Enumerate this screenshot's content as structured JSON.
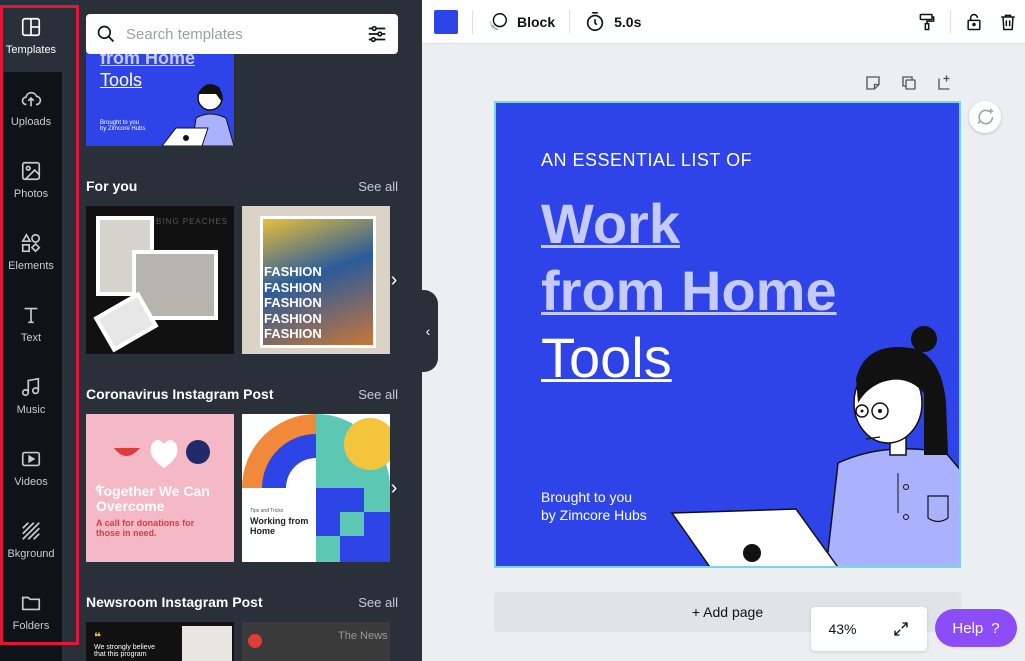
{
  "sidebar": {
    "items": [
      {
        "label": "Templates",
        "icon": "templates-icon",
        "active": true
      },
      {
        "label": "Uploads",
        "icon": "upload-icon"
      },
      {
        "label": "Photos",
        "icon": "photo-icon"
      },
      {
        "label": "Elements",
        "icon": "shapes-icon"
      },
      {
        "label": "Text",
        "icon": "text-icon"
      },
      {
        "label": "Music",
        "icon": "music-icon"
      },
      {
        "label": "Videos",
        "icon": "video-icon"
      },
      {
        "label": "Bkground",
        "icon": "background-icon"
      },
      {
        "label": "Folders",
        "icon": "folder-icon"
      }
    ]
  },
  "panel": {
    "search": {
      "placeholder": "Search templates",
      "value": ""
    },
    "top_thumb": {
      "line1": "from Home",
      "line2": "Tools",
      "credit": "Brought to you\nby Zimcore Hubs"
    },
    "sections": [
      {
        "title": "For you",
        "see_all": "See all",
        "thumbs": [
          {
            "text": "VIBING PEACHES"
          },
          {
            "text": "FASHION"
          }
        ]
      },
      {
        "title": "Coronavirus Instagram Post",
        "see_all": "See all",
        "thumbs": [
          {
            "text": "Together We Can Overcome",
            "sub": "A call for donations for those in need."
          },
          {
            "text": "Working from Home",
            "sub": "Tips and Tricks"
          }
        ]
      },
      {
        "title": "Newsroom Instagram Post",
        "see_all": "See all",
        "thumbs": [
          {
            "text": "We strongly believe that this program"
          },
          {
            "text": "The News"
          }
        ]
      }
    ]
  },
  "toolbar": {
    "color": "#2d45e6",
    "block_label": "Block",
    "duration_label": "5.0s"
  },
  "design": {
    "kicker": "AN ESSENTIAL LIST OF",
    "line1": "Work",
    "line2": "from Home",
    "line3": "Tools",
    "by1": "Brought to you",
    "by2": "by Zimcore Hubs",
    "bg_color": "#2e44e8"
  },
  "canvas": {
    "add_page_label": "+ Add page",
    "zoom": "43%"
  },
  "help": {
    "label": "Help",
    "glyph": "?"
  },
  "colors": {
    "accent": "#8c4cf7",
    "highlight": "#e0173b",
    "rail": "#0e1318",
    "panel": "#293039"
  }
}
